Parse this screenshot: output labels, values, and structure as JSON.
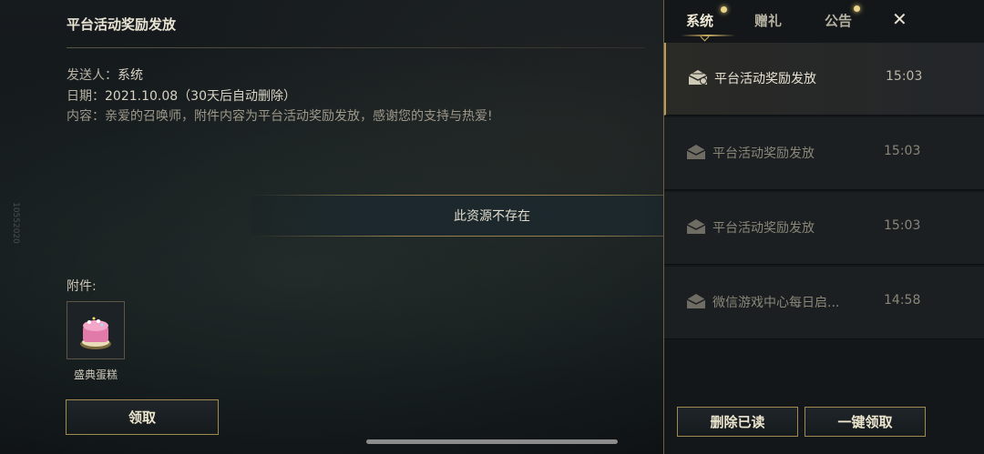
{
  "mail_detail": {
    "title": "平台活动奖励发放",
    "sender_label": "发送人：",
    "sender_value": "系统",
    "date_label": "日期：",
    "date_value": "2021.10.08",
    "date_note": "（30天后自动删除）",
    "content_label": "内容：",
    "content_value": "亲爱的召唤师，附件内容为平台活动奖励发放，感谢您的支持与热爱!",
    "attachment_label": "附件:",
    "attachment_item": "盛典蛋糕",
    "claim_button": "领取"
  },
  "toast": {
    "message": "此资源不存在"
  },
  "side_code": "10552020",
  "tabs": [
    {
      "label": "系统",
      "active": true,
      "has_dot": true
    },
    {
      "label": "赠礼",
      "active": false,
      "has_dot": false
    },
    {
      "label": "公告",
      "active": false,
      "has_dot": true
    }
  ],
  "close_label": "✕",
  "mail_list": [
    {
      "subject": "平台活动奖励发放",
      "time": "15:03",
      "selected": true,
      "icon": "mail-opened-icon"
    },
    {
      "subject": "平台活动奖励发放",
      "time": "15:03",
      "selected": false,
      "icon": "mail-icon"
    },
    {
      "subject": "平台活动奖励发放",
      "time": "15:03",
      "selected": false,
      "icon": "mail-icon"
    },
    {
      "subject": "微信游戏中心每日启...",
      "time": "14:58",
      "selected": false,
      "icon": "mail-icon"
    }
  ],
  "footer": {
    "delete_read": "删除已读",
    "claim_all": "一键领取"
  },
  "colors": {
    "accent_gold": "#b79b59",
    "notification_dot": "#ead58a"
  }
}
